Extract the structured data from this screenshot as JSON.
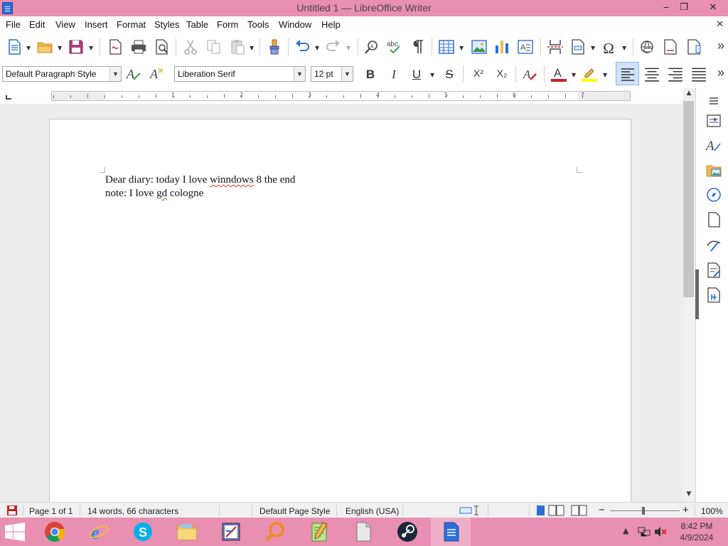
{
  "window": {
    "title": "Untitled 1 — LibreOffice Writer",
    "minimize_glyph": "‒",
    "maximize_glyph": "❐",
    "close_glyph": "✕",
    "doc_close_glyph": "✕"
  },
  "menu": {
    "file": "File",
    "edit": "Edit",
    "view": "View",
    "insert": "Insert",
    "format": "Format",
    "styles": "Styles",
    "table": "Table",
    "form": "Form",
    "tools": "Tools",
    "window": "Window",
    "help": "Help"
  },
  "formatting": {
    "paragraph_style": "Default Paragraph Style",
    "font_name": "Liberation Serif",
    "font_size": "12 pt",
    "bold": "B",
    "italic": "I",
    "underline": "U",
    "strike": "S",
    "superscript": "X²",
    "subscript": "X₂",
    "more": "»"
  },
  "ruler": {
    "numbers": [
      "1",
      "2",
      "3",
      "4",
      "5",
      "6",
      "7"
    ]
  },
  "document": {
    "line1_a": "Dear diary: today I love ",
    "line1_misspelled": "winndows",
    "line1_b": " 8 the end",
    "line2_a": "note: I love ",
    "line2_misspelled": "gd",
    "line2_b": " cologne"
  },
  "status": {
    "page": "Page 1 of 1",
    "words": "14 words, 66 characters",
    "page_style": "Default Page Style",
    "language": "English (USA)",
    "zoom": "100%",
    "zoom_minus": "−",
    "zoom_plus": "+"
  },
  "clock": {
    "time": "8:42 PM",
    "date": "4/9/2024"
  },
  "colors": {
    "title_bar": "#e98fb2",
    "taskbar": "#e98fb2",
    "font_color": "#c9211e",
    "highlight": "#ffff00",
    "accent": "#2a6fd6"
  }
}
